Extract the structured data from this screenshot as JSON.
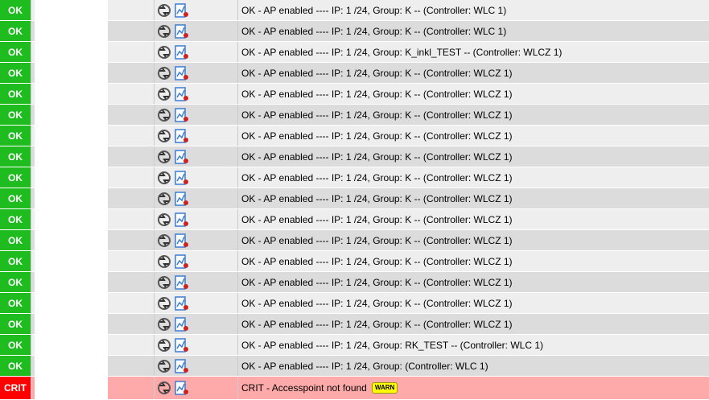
{
  "rows": [
    {
      "state": "OK",
      "output": "OK - AP enabled ---- IP: 1          /24, Group:                     K -- (Controller: WLC              1)"
    },
    {
      "state": "OK",
      "output": "OK - AP enabled ---- IP: 1          /24, Group:                     K -- (Controller: WLC              1)"
    },
    {
      "state": "OK",
      "output": "OK - AP enabled ---- IP: 1          /24, Group:                     K_inkl_TEST -- (Controller: WLCZ              1)"
    },
    {
      "state": "OK",
      "output": "OK - AP enabled ---- IP: 1          /24, Group:                     K -- (Controller: WLCZ              1)"
    },
    {
      "state": "OK",
      "output": "OK - AP enabled ---- IP: 1          /24, Group:                     K -- (Controller: WLCZ              1)"
    },
    {
      "state": "OK",
      "output": "OK - AP enabled ---- IP: 1          /24, Group:                     K -- (Controller: WLCZ              1)"
    },
    {
      "state": "OK",
      "output": "OK - AP enabled ---- IP: 1          /24, Group:                     K -- (Controller: WLCZ              1)"
    },
    {
      "state": "OK",
      "output": "OK - AP enabled ---- IP: 1          /24, Group:                     K -- (Controller: WLCZ              1)"
    },
    {
      "state": "OK",
      "output": "OK - AP enabled ---- IP: 1          /24, Group:                     K -- (Controller: WLCZ              1)"
    },
    {
      "state": "OK",
      "output": "OK - AP enabled ---- IP: 1          /24, Group:                     K -- (Controller: WLCZ              1)"
    },
    {
      "state": "OK",
      "output": "OK - AP enabled ---- IP: 1          /24, Group:                     K -- (Controller: WLCZ              1)"
    },
    {
      "state": "OK",
      "output": "OK - AP enabled ---- IP: 1          /24, Group:                     K -- (Controller: WLCZ              1)"
    },
    {
      "state": "OK",
      "output": "OK - AP enabled ---- IP: 1          /24, Group:                     K -- (Controller: WLCZ              1)"
    },
    {
      "state": "OK",
      "output": "OK - AP enabled ---- IP: 1          /24, Group:                     K -- (Controller: WLCZ              1)"
    },
    {
      "state": "OK",
      "output": "OK - AP enabled ---- IP: 1          /24, Group:                     K -- (Controller: WLCZ              1)"
    },
    {
      "state": "OK",
      "output": "OK - AP enabled ---- IP: 1          /24, Group:                     K -- (Controller: WLCZ              1)"
    },
    {
      "state": "OK",
      "output": "OK - AP enabled ---- IP: 1          /24, Group:                     RK_TEST -- (Controller: WLC              1)"
    },
    {
      "state": "OK",
      "output": "OK - AP enabled ---- IP: 1          /24, Group:                      (Controller: WLC              1)"
    }
  ],
  "crit_row": {
    "state": "CRIT",
    "output": "CRIT - Accesspoint not found",
    "badge": "WARN"
  },
  "colors": {
    "ok": "#1ebc1e",
    "crit": "#ff0000",
    "crit_bg": "#ffaaaa",
    "badge": "#ffff00"
  },
  "icons": {
    "reschedule": "reschedule-icon",
    "graph": "pnp-graph-icon"
  }
}
